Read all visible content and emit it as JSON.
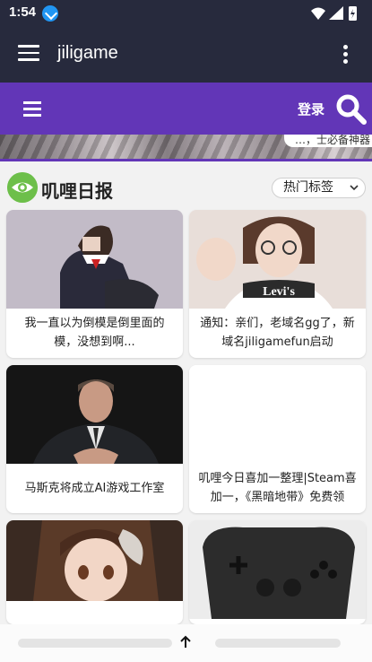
{
  "status_bar": {
    "time": "1:54"
  },
  "app_bar": {
    "title": "jiligame"
  },
  "site_bar": {
    "login_label": "登录"
  },
  "banner": {
    "caption": "…，士必备神器"
  },
  "section": {
    "title": "叽哩日报",
    "tags_label": "热门标签"
  },
  "articles": [
    {
      "title": "我一直以为倒模是倒里面的模，没想到啊..."
    },
    {
      "title": "通知：亲们，老域名gg了，新域名jiligamefun启动"
    },
    {
      "title": "马斯克将成立AI游戏工作室"
    },
    {
      "title": "叽哩今日喜加一整理|Steam喜加一，《黑暗地带》免费领"
    },
    {
      "title": ""
    },
    {
      "title": ""
    }
  ],
  "colors": {
    "app_bar": "#272a3d",
    "site_bar": "#6236b7",
    "eye_icon": "#6dbf4a"
  }
}
